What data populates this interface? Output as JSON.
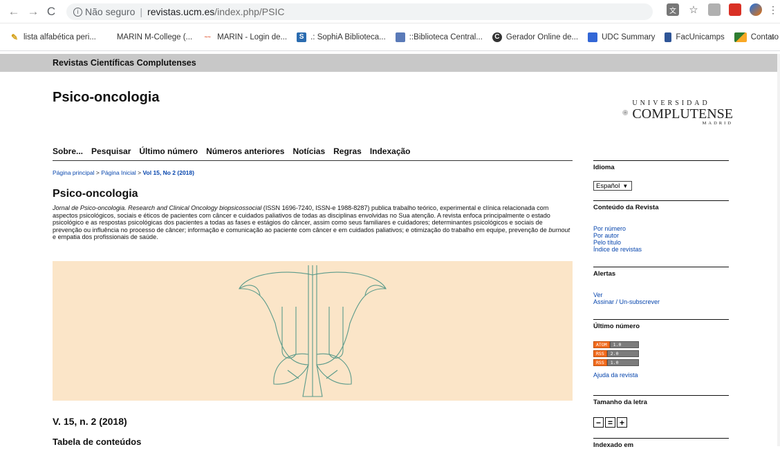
{
  "browser": {
    "security_label": "Não seguro",
    "url_host": "revistas.ucm.es",
    "url_path": "/index.php/PSIC",
    "bookmarks": [
      "lista alfabética peri...",
      "MARIN M-College (...",
      "MARIN - Login de...",
      ".: SophiA Biblioteca...",
      "::Biblioteca Central...",
      "Gerador Online de...",
      "UDC Summary",
      "FacUnicamps",
      "Contato — IBICT"
    ],
    "more_label": "»"
  },
  "site": {
    "topbar_title": "Revistas Científicas Complutenses",
    "journal_title": "Psico-oncologia",
    "logo": {
      "line1": "UNIVERSIDAD",
      "line2": "COMPLUTENSE",
      "line3": "MADRID"
    }
  },
  "nav": [
    "Sobre...",
    "Pesquisar",
    "Último número",
    "Números anteriores",
    "Notícias",
    "Regras",
    "Indexação"
  ],
  "breadcrumb": {
    "home": "Página principal",
    "sep": ">",
    "inicial": "Página Inicial",
    "current": "Vol 15, No 2 (2018)"
  },
  "main": {
    "heading": "Psico-oncologia",
    "desc_em1": "Jornal de Psico-oncologia. Research and Clinical Oncology biopsicossocial",
    "desc_1": " (ISSN 1696-7240, ISSN-e 1988-8287) publica trabalho teórico, experimental e clínica relacionada com aspectos psicológicos, sociais e éticos de pacientes com câncer e cuidados paliativos de todas as disciplinas envolvidas no Sua atenção. A revista enfoca principalmente o estado psicológico e as respostas psicológicas dos pacientes a todas as fases e estágios do câncer, assim como seus familiares e cuidadores; determinantes psicológicos e sociais de prevenção ou influência no processo de câncer; informação e comunicação ao paciente com câncer e em cuidados paliativos; e otimização do trabalho em equipe, prevenção de ",
    "desc_em2": "burnout",
    "desc_2": " e empatia dos profissionais de saúde.",
    "volume": "V. 15, n. 2 (2018)",
    "toc": "Tabela de conteúdos"
  },
  "sidebar": {
    "idioma": "Idioma",
    "idioma_value": "Español",
    "conteudo": "Conteúdo da Revista",
    "conteudo_links": [
      "Por número",
      "Por autor",
      "Pelo título",
      "Índice de revistas"
    ],
    "alertas": "Alertas",
    "alertas_links": [
      "Ver",
      "Assinar / Un-subscrever"
    ],
    "ultimo": "Último número",
    "feeds": [
      {
        "type": "ATOM",
        "version": "1.0"
      },
      {
        "type": "RSS",
        "version": "2.0"
      },
      {
        "type": "RSS",
        "version": "1.0"
      }
    ],
    "ajuda": "Ajuda da revista",
    "tamanho": "Tamanho da letra",
    "font_buttons": [
      "−",
      "=",
      "+"
    ],
    "indexado": "Indexado em"
  },
  "colors": {
    "banner_bg": "#fbe5c8",
    "link": "#0645ad",
    "topbar": "#c8c8c8"
  }
}
